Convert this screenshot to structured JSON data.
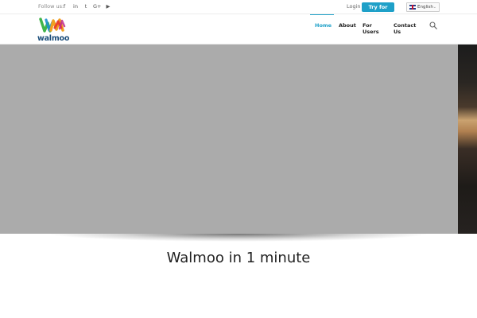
{
  "topbar": {
    "follow_label": "Follow us:",
    "social": [
      {
        "icon": "facebook-icon",
        "glyph": "f"
      },
      {
        "icon": "linkedin-icon",
        "glyph": "in"
      },
      {
        "icon": "twitter-icon",
        "glyph": "t"
      },
      {
        "icon": "google-plus-icon",
        "glyph": "G+"
      },
      {
        "icon": "youtube-icon",
        "glyph": "▶"
      }
    ],
    "login_label": "Login",
    "try_label": "Try for free",
    "language": "English"
  },
  "header": {
    "logo_text": "walmoo",
    "nav": [
      {
        "label": "Home",
        "active": true
      },
      {
        "label": "About",
        "active": false
      },
      {
        "label": "For Users",
        "active": false
      },
      {
        "label": "Contact Us",
        "active": false
      }
    ]
  },
  "main": {
    "headline": "Walmoo in 1 minute"
  },
  "colors": {
    "accent": "#1ea0c8",
    "hero_bg": "#ababab",
    "logo_text": "#1a4d7a"
  }
}
